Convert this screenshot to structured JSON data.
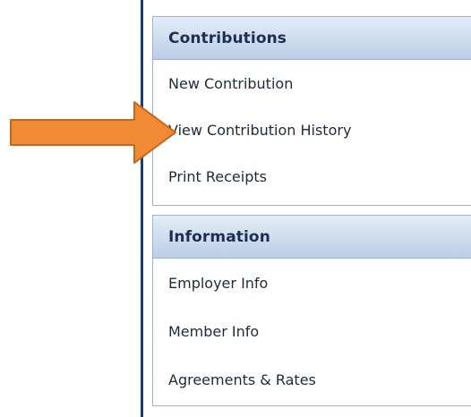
{
  "nav": {
    "groups": [
      {
        "title": "Contributions",
        "items": [
          {
            "label": "New Contribution"
          },
          {
            "label": "View Contribution History"
          },
          {
            "label": "Print Receipts"
          }
        ]
      },
      {
        "title": "Information",
        "items": [
          {
            "label": "Employer Info"
          },
          {
            "label": "Member Info"
          },
          {
            "label": "Agreements & Rates"
          }
        ]
      }
    ]
  },
  "annotation": {
    "arrow_icon": "right-arrow-icon",
    "arrow_color": "#f08a34",
    "arrow_outline_color": "#c8651a"
  },
  "colors": {
    "header_text": "#1d2f4f",
    "panel_border": "#9fb4cf",
    "nav_rule": "#1c3d6e"
  }
}
